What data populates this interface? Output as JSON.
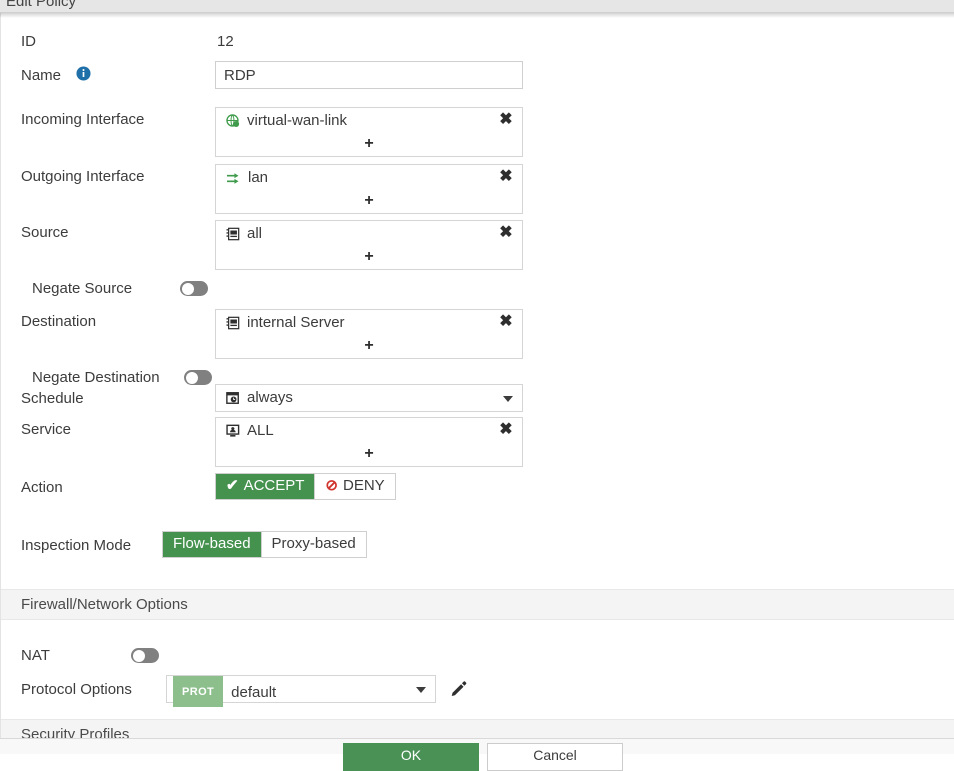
{
  "window": {
    "title": "Edit Policy"
  },
  "form": {
    "id": {
      "label": "ID",
      "value": "12"
    },
    "name": {
      "label": "Name",
      "value": "RDP",
      "info_icon": "info-circle-icon"
    },
    "incoming_interface": {
      "label": "Incoming Interface",
      "items": [
        {
          "text": "virtual-wan-link",
          "icon": "sdwan-globe-icon"
        }
      ],
      "add_label": "+",
      "remove_label": "✖"
    },
    "outgoing_interface": {
      "label": "Outgoing Interface",
      "items": [
        {
          "text": "lan",
          "icon": "interface-arrows-icon"
        }
      ],
      "add_label": "+",
      "remove_label": "✖"
    },
    "source": {
      "label": "Source",
      "items": [
        {
          "text": "all",
          "icon": "address-object-icon"
        }
      ],
      "add_label": "+",
      "remove_label": "✖"
    },
    "negate_source": {
      "label": "Negate Source",
      "state": "off"
    },
    "destination": {
      "label": "Destination",
      "items": [
        {
          "text": "internal Server",
          "icon": "address-object-icon"
        }
      ],
      "add_label": "+",
      "remove_label": "✖"
    },
    "negate_destination": {
      "label": "Negate Destination",
      "state": "off"
    },
    "schedule": {
      "label": "Schedule",
      "value": "always",
      "icon": "schedule-clock-icon"
    },
    "service": {
      "label": "Service",
      "items": [
        {
          "text": "ALL",
          "icon": "service-monitor-icon"
        }
      ],
      "add_label": "+",
      "remove_label": "✖"
    },
    "action": {
      "label": "Action",
      "selected": "ACCEPT",
      "options": [
        {
          "label": "ACCEPT",
          "icon": "check-icon",
          "selected": true
        },
        {
          "label": "DENY",
          "icon": "deny-circle-icon",
          "selected": false
        }
      ]
    },
    "inspection_mode": {
      "label": "Inspection Mode",
      "selected": "Flow-based",
      "options": [
        {
          "label": "Flow-based",
          "selected": true
        },
        {
          "label": "Proxy-based",
          "selected": false
        }
      ]
    }
  },
  "firewall_network_options": {
    "header": "Firewall/Network Options",
    "nat": {
      "label": "NAT",
      "state": "off"
    },
    "protocol_options": {
      "label": "Protocol Options",
      "badge": "PROT",
      "value": "default",
      "edit_icon": "pencil-icon"
    }
  },
  "security_profiles": {
    "header": "Security Profiles"
  },
  "footer": {
    "ok_label": "OK",
    "cancel_label": "Cancel"
  },
  "colors": {
    "accent_green": "#45924f",
    "badge_green": "#8dbf8c",
    "deny_red": "#d0342c",
    "info_blue": "#1f6fa8",
    "toggle_off": "#808080",
    "section_band": "#f4f4f4"
  }
}
